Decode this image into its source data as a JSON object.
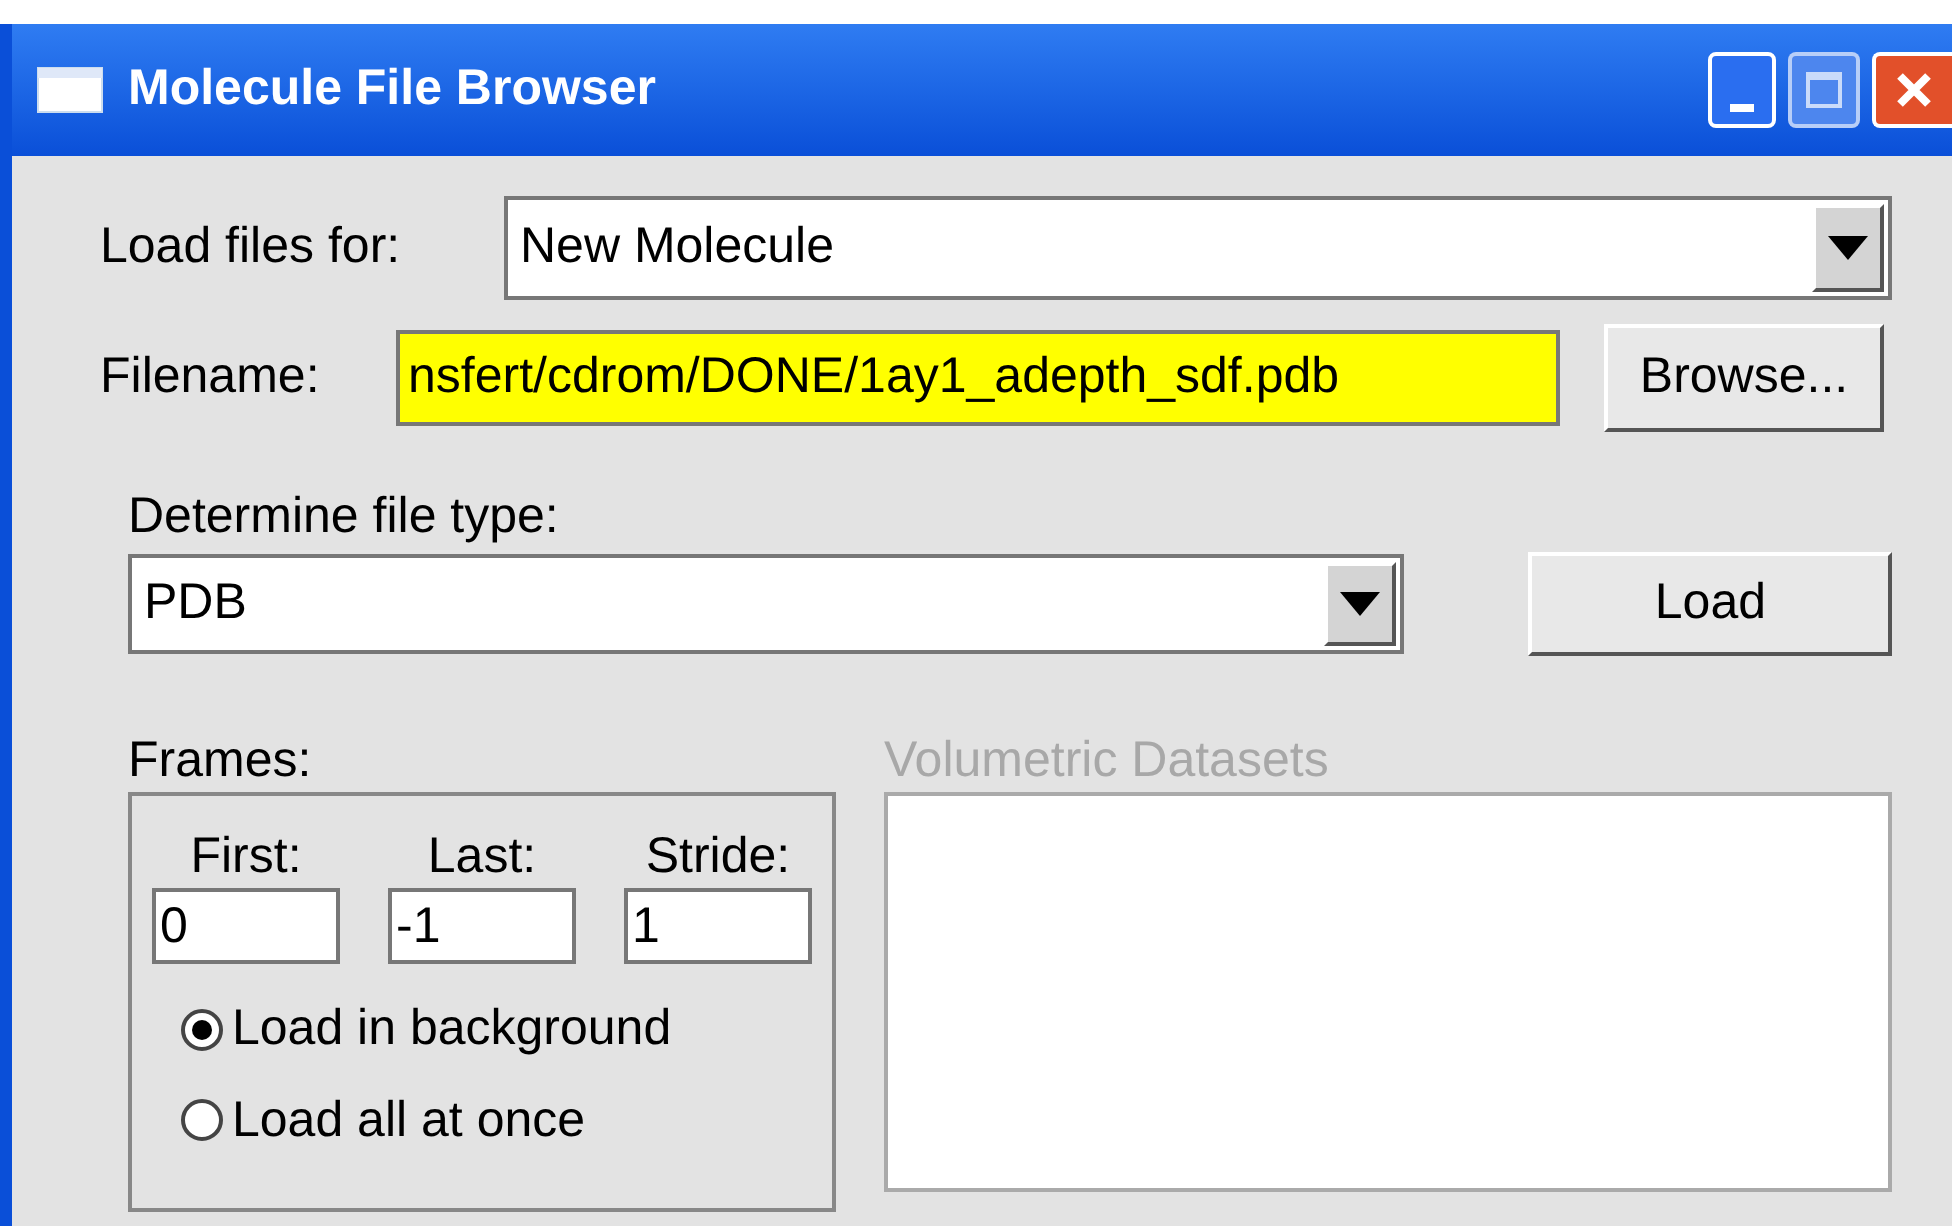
{
  "window": {
    "title": "Molecule File Browser"
  },
  "load_for": {
    "label": "Load files for:",
    "value": "New Molecule"
  },
  "filename": {
    "label": "Filename:",
    "value": "nsfert/cdrom/DONE/1ay1_adepth_sdf.pdb",
    "highlighted": true
  },
  "browse_button": "Browse...",
  "file_type": {
    "label": "Determine file type:",
    "value": "PDB"
  },
  "load_button": "Load",
  "frames": {
    "label": "Frames:",
    "fields": [
      {
        "label": "First:",
        "value": "0"
      },
      {
        "label": "Last:",
        "value": "-1"
      },
      {
        "label": "Stride:",
        "value": "1"
      }
    ],
    "modes": [
      {
        "label": "Load in background",
        "selected": true
      },
      {
        "label": "Load all at once",
        "selected": false
      }
    ]
  },
  "volumetric": {
    "label": "Volumetric Datasets",
    "disabled": true
  }
}
